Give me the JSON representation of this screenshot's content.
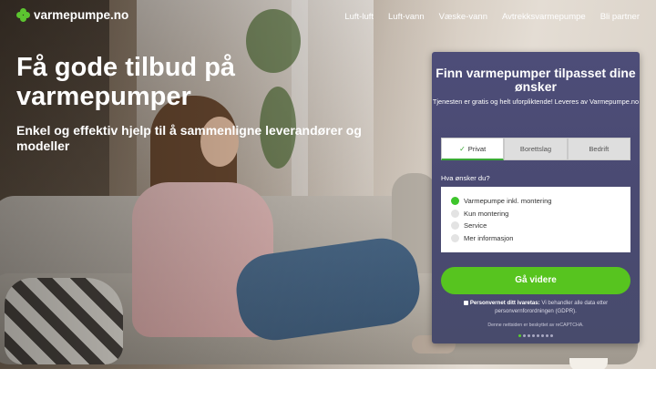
{
  "site": {
    "logo_text": "varmepumpe.no",
    "brand_color": "#5cc530"
  },
  "nav": {
    "items": [
      "Luft-luft",
      "Luft-vann",
      "Væske-vann",
      "Avtrekksvarmepumpe",
      "Bli partner"
    ]
  },
  "hero": {
    "title": "Få gode tilbud på varmepumper",
    "subtitle": "Enkel og effektiv hjelp til å sammenligne leverandører og modeller"
  },
  "form": {
    "title": "Finn varmepumper tilpasset dine ønsker",
    "subtitle": "Tjenesten er gratis og helt uforpliktende! Leveres av Varmepumpe.no",
    "tabs": [
      {
        "label": "Privat",
        "active": true
      },
      {
        "label": "Borettslag",
        "active": false
      },
      {
        "label": "Bedrift",
        "active": false
      }
    ],
    "question": "Hva ønsker du?",
    "options": [
      {
        "label": "Varmepumpe inkl. montering",
        "selected": true
      },
      {
        "label": "Kun montering",
        "selected": false
      },
      {
        "label": "Service",
        "selected": false
      },
      {
        "label": "Mer informasjon",
        "selected": false
      }
    ],
    "submit_label": "Gå videre",
    "privacy_strong": "Personvernet ditt ivaretas:",
    "privacy_text": "Vi behandler alle data etter personvernforordningen (GDPR).",
    "recaptcha_text": "Denne nettsiden er beskyttet av reCAPTCHA.",
    "progress_step": 1,
    "progress_total": 8,
    "accent_color": "#57c41f"
  }
}
